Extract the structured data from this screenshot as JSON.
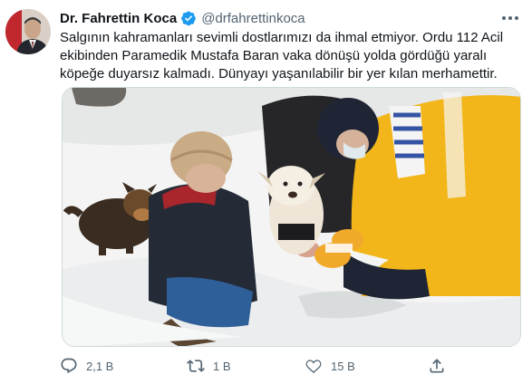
{
  "tweet": {
    "display_name": "Dr. Fahrettin Koca",
    "handle": "@drfahrettinkoca",
    "text": "Salgının kahramanları sevimli dostlarımızı da ihmal etmiyor. Ordu 112 Acil ekibinden Paramedik Mustafa Baran vaka dönüşü yolda gördüğü yaralı köpeğe duyarsız kalmadı. Dünyayı yaşanılabilir bir yer kılan merhamettir."
  },
  "actions": {
    "reply_count": "2,1 B",
    "retweet_count": "1 B",
    "like_count": "15 B"
  },
  "icons": {
    "verified": "verified-badge-icon",
    "more": "more-icon",
    "reply": "reply-icon",
    "retweet": "retweet-icon",
    "like": "heart-icon",
    "share": "share-icon"
  },
  "colors": {
    "accent": "#1d9bf0",
    "text": "#0f1419",
    "secondary": "#536471"
  }
}
